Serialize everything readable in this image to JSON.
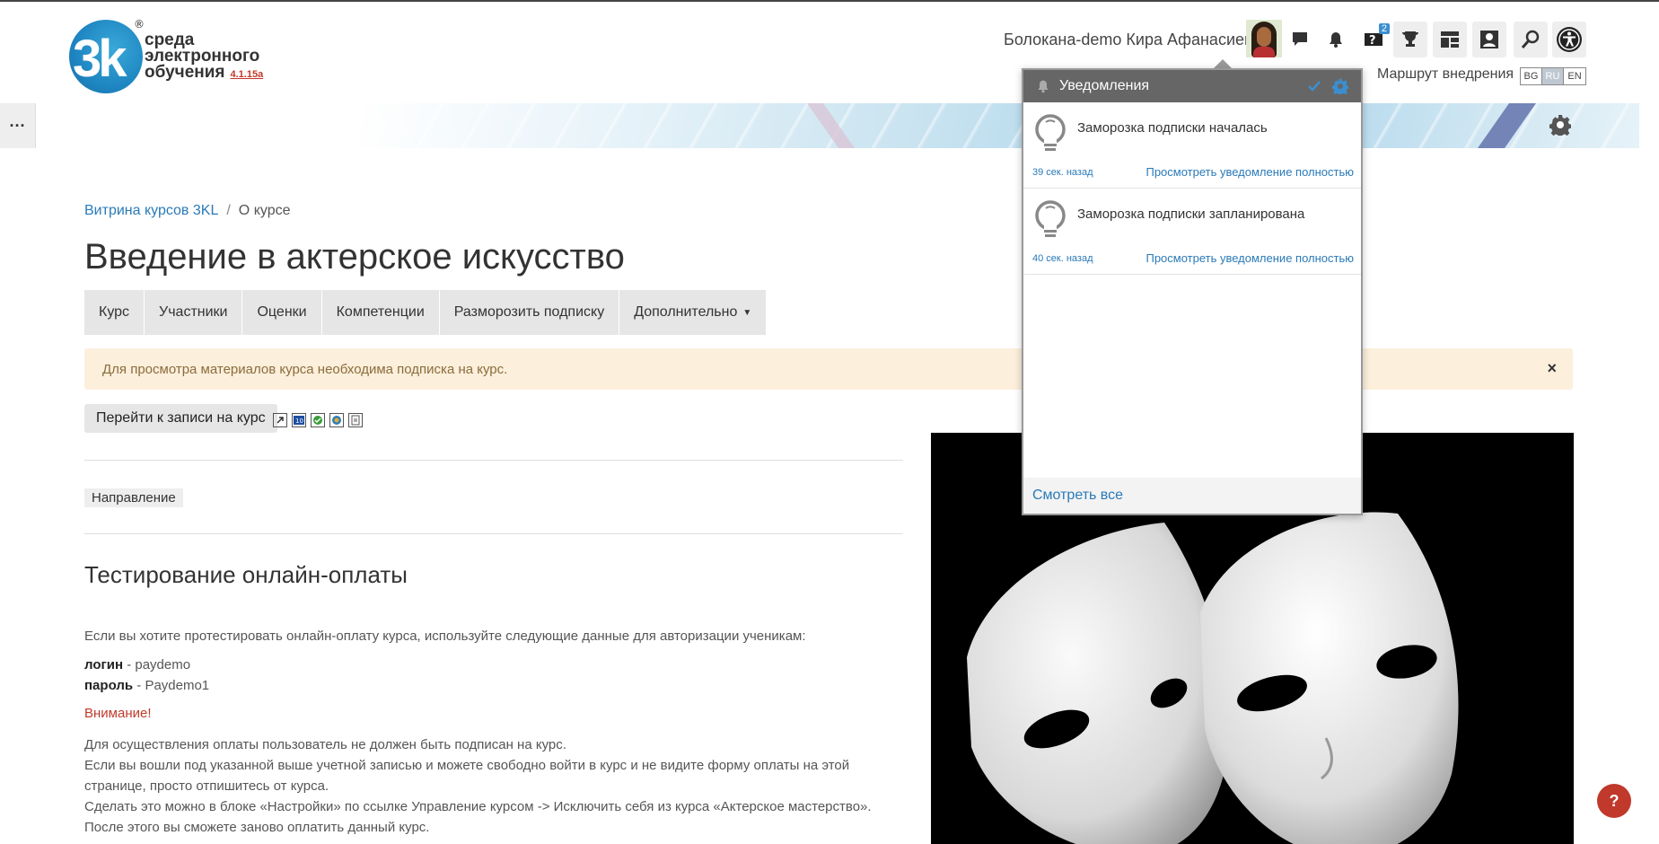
{
  "header": {
    "logo_text_line1": "среда",
    "logo_text_line2": "электронного",
    "logo_text_line3": "обучения",
    "logo_version": "4.1.15a",
    "logo_mark": "3k",
    "logo_reg": "®",
    "user_name": "Болокана-demo Кира Афанасиевна",
    "help_badge": "2",
    "route_link": "Маршрут внедрения",
    "languages": [
      "BG",
      "RU",
      "EN"
    ],
    "active_language": "RU"
  },
  "nav": {
    "menu_dots": "···"
  },
  "breadcrumb": {
    "items": [
      "Витрина курсов 3KL",
      "О курсе"
    ],
    "separator": "/"
  },
  "page_title": "Введение в актерское искусство",
  "tabs": [
    {
      "label": "Курс"
    },
    {
      "label": "Участники"
    },
    {
      "label": "Оценки"
    },
    {
      "label": "Компетенции"
    },
    {
      "label": "Разморозить подписку"
    },
    {
      "label": "Дополнительно"
    }
  ],
  "alert": {
    "text": "Для просмотра материалов курса необходима подписка на курс.",
    "close": "×"
  },
  "enroll_button": "Перейти к записи на курс",
  "tag": "Направление",
  "section": {
    "title": "Тестирование онлайн-оплаты",
    "intro": "Если вы хотите протестировать онлайн-оплату курса, используйте следующие данные для авторизации ученикам:",
    "login_label": "логин",
    "login_value": " - paydemo",
    "password_label": "пароль",
    "password_value": " - Paydemo1",
    "warning": "Внимание!",
    "body_lines": [
      "Для осуществления оплаты пользователь не должен быть подписан на курс.",
      "Если вы вошли под указанной выше учетной записью и можете свободно войти в курс и не видите форму оплаты на этой странице, просто отпишитесь от курса.",
      "Сделать это можно в блоке «Настройки» по ссылке Управление курсом -> Исключить себя из курса «Актерское мастерство».",
      "После этого вы сможете заново оплатить данный курс."
    ]
  },
  "notifications": {
    "title": "Уведомления",
    "items": [
      {
        "text": "Заморозка подписки началась",
        "time": "39 сек. назад",
        "view": "Просмотреть уведомление полностью"
      },
      {
        "text": "Заморозка подписки запланирована",
        "time": "40 сек. назад",
        "view": "Просмотреть уведомление полностью"
      }
    ],
    "see_all": "Смотреть все"
  },
  "help_button": "?",
  "colors": {
    "link": "#2a7ab8",
    "accent_red": "#c0392b",
    "alert_bg": "#fcefdc",
    "tab_bg": "#e6e6e6"
  }
}
